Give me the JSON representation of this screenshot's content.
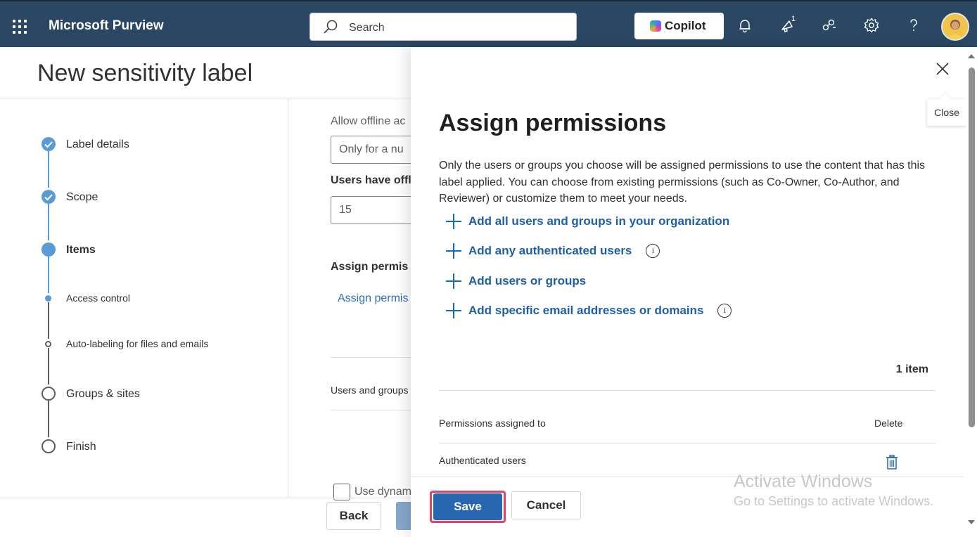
{
  "header": {
    "app_title": "Microsoft Purview",
    "search_placeholder": "Search",
    "copilot_label": "Copilot",
    "notification_badge": "1",
    "icons": [
      "waffle-icon",
      "search-icon",
      "bell-icon",
      "megaphone-icon",
      "share-icon",
      "gear-icon",
      "help-icon",
      "avatar"
    ]
  },
  "page": {
    "title": "New sensitivity label",
    "steps": [
      {
        "label": "Label details",
        "state": "done"
      },
      {
        "label": "Scope",
        "state": "done"
      },
      {
        "label": "Items",
        "state": "current"
      },
      {
        "label": "Access control",
        "state": "current-sub"
      },
      {
        "label": "Auto-labeling for files and emails",
        "state": "sub"
      },
      {
        "label": "Groups & sites",
        "state": "todo"
      },
      {
        "label": "Finish",
        "state": "todo"
      }
    ],
    "bg": {
      "offline_label": "Allow offline ac",
      "offline_value": "Only for a nu",
      "users_offline_label": "Users have offl",
      "users_offline_value": "15",
      "assign_heading": "Assign permis",
      "assign_link": "Assign permis",
      "users_groups_col": "Users and groups",
      "use_dynamic": "Use dynam",
      "back_label": "Back"
    }
  },
  "panel": {
    "close_tooltip": "Close",
    "title": "Assign permissions",
    "description": "Only the users or groups you choose will be assigned permissions to use the content that has this label applied. You can choose from existing permissions (such as Co-Owner, Co-Author, and Reviewer) or customize them to meet your needs.",
    "actions": [
      {
        "label": "Add all users and groups in your organization",
        "info": false
      },
      {
        "label": "Add any authenticated users",
        "info": true
      },
      {
        "label": "Add users or groups",
        "info": false
      },
      {
        "label": "Add specific email addresses or domains",
        "info": true
      }
    ],
    "item_count": "1 item",
    "table": {
      "columns": [
        "Permissions assigned to",
        "Delete"
      ],
      "rows": [
        {
          "assigned_to": "Authenticated users"
        }
      ]
    },
    "save_label": "Save",
    "cancel_label": "Cancel"
  },
  "watermark": {
    "line1": "Activate Windows",
    "line2": "Go to Settings to activate Windows."
  },
  "colors": {
    "header_bg": "#2b4763",
    "accent": "#2866b1",
    "link": "#1f5fa8",
    "highlight": "#e0426f"
  }
}
